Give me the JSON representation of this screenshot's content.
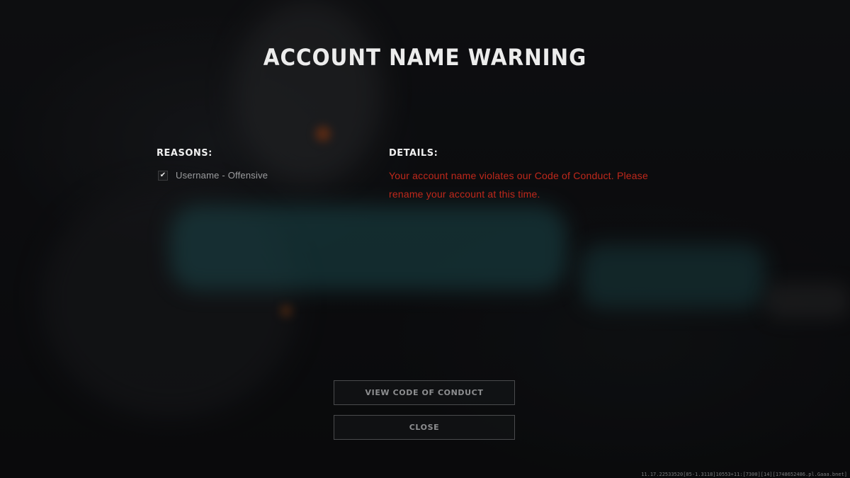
{
  "dialog": {
    "title": "ACCOUNT NAME WARNING",
    "reasons_heading": "REASONS:",
    "details_heading": "DETAILS:",
    "reasons": [
      {
        "label": "Username - Offensive",
        "checked": true
      }
    ],
    "details_text": "Your account name violates our Code of Conduct. Please rename your account at this time."
  },
  "buttons": {
    "view_code_of_conduct": "VIEW CODE OF CONDUCT",
    "close": "CLOSE"
  },
  "footer": {
    "build_info": "11.17.22533520[85-1.3118]10553+11:[7300][14][1748652486.pl.Gaaa.bnet]"
  },
  "colors": {
    "details_text": "#c0281b",
    "title": "#ececec",
    "button_border": "#4a4b4d"
  },
  "icons": {
    "checkbox": "check-icon"
  }
}
